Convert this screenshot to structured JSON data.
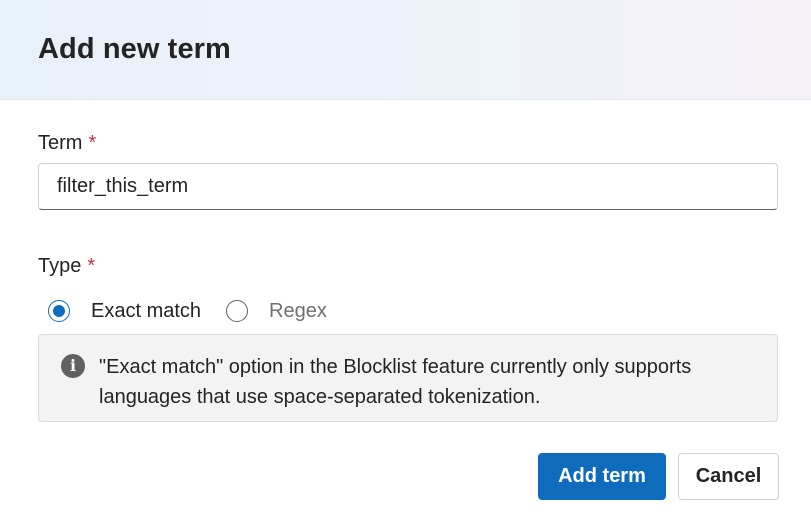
{
  "dialog": {
    "title": "Add new term"
  },
  "term_field": {
    "label": "Term",
    "required_mark": "*",
    "value": "filter_this_term"
  },
  "type_field": {
    "label": "Type",
    "required_mark": "*",
    "options": [
      {
        "label": "Exact match",
        "selected": true
      },
      {
        "label": "Regex",
        "selected": false
      }
    ]
  },
  "info": {
    "icon": "info-icon",
    "glyph": "i",
    "message": "\"Exact match\" option in the Blocklist feature currently only supports languages that use space-separated tokenization."
  },
  "actions": {
    "primary_label": "Add term",
    "secondary_label": "Cancel"
  },
  "colors": {
    "accent": "#0f6cbd",
    "required": "#c4314b",
    "info_background": "#f3f3f3"
  }
}
